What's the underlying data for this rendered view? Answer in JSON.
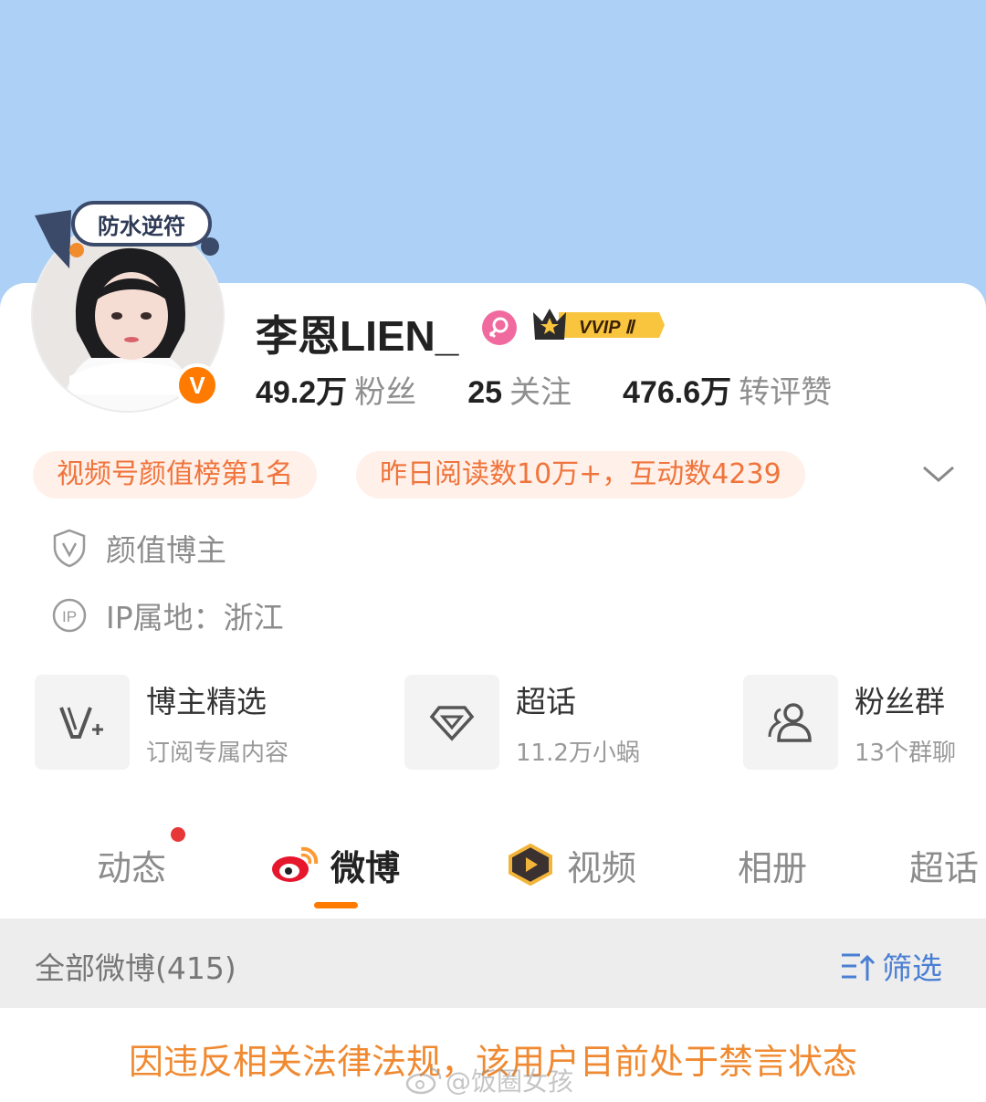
{
  "profile": {
    "name": "李恩LIEN_",
    "pendant_text": "防水逆符",
    "verified_badge": "V",
    "vip_label": "VVIP Ⅱ",
    "stats": [
      {
        "num": "49.2万",
        "label": "粉丝"
      },
      {
        "num": "25",
        "label": "关注"
      },
      {
        "num": "476.6万",
        "label": "转评赞"
      }
    ]
  },
  "tags": [
    "视频号颜值榜第1名",
    "昨日阅读数10万+，互动数4239"
  ],
  "info": {
    "category": "颜值博主",
    "ip": "IP属地：浙江"
  },
  "services": [
    {
      "title": "博主精选",
      "sub": "订阅专属内容",
      "icon": "v-plus-icon"
    },
    {
      "title": "超话",
      "sub": "11.2万小蜗",
      "icon": "diamond-icon"
    },
    {
      "title": "粉丝群",
      "sub": "13个群聊",
      "icon": "group-icon"
    }
  ],
  "tabs": [
    "动态",
    "微博",
    "视频",
    "相册",
    "超话"
  ],
  "filter_bar": {
    "all_label": "全部微博(415)",
    "filter_label": "筛选"
  },
  "notice": "因违反相关法律法规，该用户目前处于禁言状态",
  "watermark": "@饭圈女孩",
  "colors": {
    "cover": "#acd0f6",
    "accent_orange": "#ff7a00",
    "tag_text": "#f0743b",
    "tag_bg": "#fff0e9",
    "filter_blue": "#4a7fd3",
    "notice": "#f08a32"
  }
}
